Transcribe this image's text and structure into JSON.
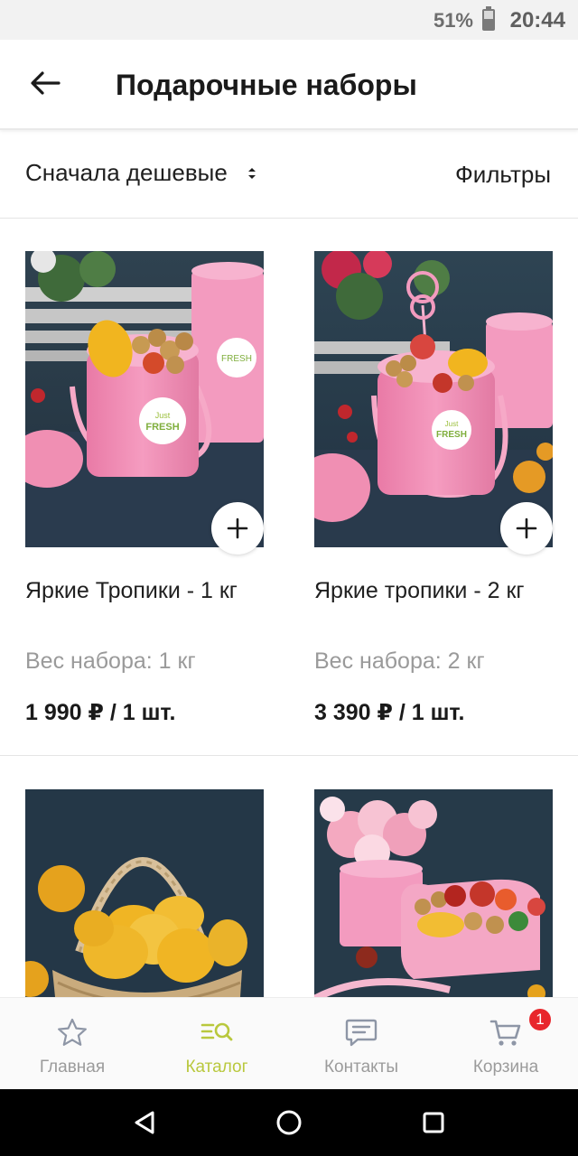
{
  "status_bar": {
    "battery": "51%",
    "time": "20:44"
  },
  "app_bar": {
    "title": "Подарочные наборы"
  },
  "toolbar": {
    "sort_label": "Сначала дешевые",
    "filters_label": "Фильтры"
  },
  "products": [
    {
      "name": "Яркие Тропики - 1 кг",
      "weight": "Вес набора: 1 кг",
      "price": "1 990 ₽ / 1 шт."
    },
    {
      "name": "Яркие тропики - 2 кг",
      "weight": "Вес набора: 2 кг",
      "price": "3 390 ₽ / 1 шт."
    },
    {
      "name": "",
      "weight": "",
      "price": ""
    },
    {
      "name": "",
      "weight": "",
      "price": ""
    }
  ],
  "product_logo_lines": [
    "Just",
    "FRESH"
  ],
  "bottom_nav": {
    "items": [
      {
        "label": "Главная",
        "icon": "star-icon"
      },
      {
        "label": "Каталог",
        "icon": "catalog-search-icon",
        "active": true
      },
      {
        "label": "Контакты",
        "icon": "chat-icon"
      },
      {
        "label": "Корзина",
        "icon": "cart-icon"
      }
    ],
    "cart_count": "1"
  },
  "colors": {
    "accent": "#b9c83d",
    "badge": "#e8262c",
    "box_pink": "#f08fb3",
    "backdrop": "#25394a"
  }
}
